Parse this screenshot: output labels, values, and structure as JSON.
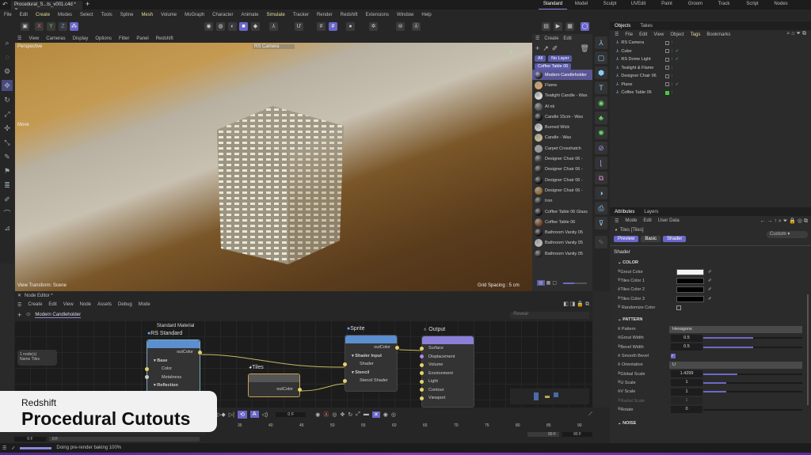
{
  "topbar": {
    "doc_tab": "Procedural_S...ts_v001.c4d *",
    "layouts": [
      "Standard",
      "Model",
      "Sculpt",
      "UVEdit",
      "Paint",
      "Groom",
      "Track",
      "Script",
      "Nodes"
    ]
  },
  "menu": [
    "File",
    "Edit",
    "Create",
    "Modes",
    "Select",
    "Tools",
    "Spline",
    "Mesh",
    "Volume",
    "MoGraph",
    "Character",
    "Animate",
    "Simulate",
    "Tracker",
    "Render",
    "Redshift",
    "Extensions",
    "Window",
    "Help"
  ],
  "toolbar": {
    "x": "X",
    "y": "Y",
    "z": "Z"
  },
  "viewport": {
    "menu": [
      "View",
      "Cameras",
      "Display",
      "Options",
      "Filter",
      "Panel",
      "Redshift"
    ],
    "label": "Perspective",
    "camera": "RS Camera",
    "move": "Move",
    "transform": "View Transform: Scene",
    "grid": "Grid Spacing : 5 cm"
  },
  "materials": {
    "menu": [
      "Create",
      "Edit"
    ],
    "all": "All",
    "nolayer": "No Layer",
    "layer": "Coffee Table 06",
    "items": [
      {
        "n": "Modern Candleholder",
        "c": "#222"
      },
      {
        "n": "Flame",
        "c": "#d8a060"
      },
      {
        "n": "Tealight Candle - Wax",
        "c": "#ddd"
      },
      {
        "n": "Al nk",
        "c": "#555"
      },
      {
        "n": "Candle 15cm - Wax",
        "c": "#111"
      },
      {
        "n": "Burned Wick",
        "c": "#ccc"
      },
      {
        "n": "Candle - Wax",
        "c": "#c8b888"
      },
      {
        "n": "Carpet Crosshatch",
        "c": "#999"
      },
      {
        "n": "Designer Chair 06 -",
        "c": "#333"
      },
      {
        "n": "Designer Chair 06 -",
        "c": "#222"
      },
      {
        "n": "Designer Chair 06 -",
        "c": "#111"
      },
      {
        "n": "Designer Chair 06 -",
        "c": "#9a6a30"
      },
      {
        "n": "Iron",
        "c": "#222"
      },
      {
        "n": "Coffee Table 06 Glass",
        "c": "#111"
      },
      {
        "n": "Coffee Table 06",
        "c": "#7a4420"
      },
      {
        "n": "Bathroom Vanity 05",
        "c": "#111"
      },
      {
        "n": "Bathroom Vanity 05",
        "c": "#bbb"
      },
      {
        "n": "Bathroom Vanity 05",
        "c": "#222"
      }
    ]
  },
  "objects": {
    "tabs": [
      "Objects",
      "Takes"
    ],
    "menu": [
      "File",
      "Edit",
      "View",
      "Object",
      "Tags",
      "Bookmarks"
    ],
    "items": [
      {
        "n": "RS Camera",
        "ok": false
      },
      {
        "n": "Cube",
        "ok": true
      },
      {
        "n": "RS Dome Light",
        "ok": true
      },
      {
        "n": "Tealight & Flame",
        "ok": false
      },
      {
        "n": "Designer Chair 06",
        "ok": false
      },
      {
        "n": "Plane",
        "ok": true
      },
      {
        "n": "Coffee Table 06",
        "ok": false
      }
    ]
  },
  "attributes": {
    "tabs": [
      "Attributes",
      "Layers"
    ],
    "menu": [
      "Mode",
      "Edit",
      "User Data"
    ],
    "object": "Tiles [Tiles]",
    "preset": "Custom",
    "subtabs": [
      "Preview",
      "Basic",
      "Shader"
    ],
    "section": "Shader",
    "color_title": "COLOR",
    "colors": [
      {
        "n": "Grout Color",
        "c": "#f4f4f4"
      },
      {
        "n": "Tiles Color 1",
        "c": "#000000"
      },
      {
        "n": "Tiles Color 2",
        "c": "#000000"
      },
      {
        "n": "Tiles Color 3",
        "c": "#000000"
      }
    ],
    "randomize": "Randomize Color",
    "pattern_title": "PATTERN",
    "pattern_label": "Pattern",
    "pattern": "Hexagons",
    "sliders": [
      {
        "n": "Grout Width",
        "v": "0.5",
        "f": 0.5
      },
      {
        "n": "Bevel Width",
        "v": "0.5",
        "f": 0.5
      }
    ],
    "smooth": "Smooth Bevel",
    "orientation_label": "Orientation",
    "orientation": "U",
    "sliders2": [
      {
        "n": "Global Scale",
        "v": "1.4299",
        "f": 0.34
      },
      {
        "n": "U Scale",
        "v": "1",
        "f": 0.23
      },
      {
        "n": "V Scale",
        "v": "1",
        "f": 0.23
      },
      {
        "n": "Radial Scale",
        "v": "1",
        "f": 0,
        "dim": true
      },
      {
        "n": "Rotate",
        "v": "0",
        "f": 0
      }
    ],
    "noise_title": "NOISE"
  },
  "nodeeditor": {
    "title": "Node Editor *",
    "menu": [
      "Create",
      "Edit",
      "View",
      "Node",
      "Assets",
      "Debug",
      "Mode"
    ],
    "tab": "Modern Candleholder",
    "search_placeholder": "Reveal",
    "info": "1 node(s)",
    "info2": "Name    Tiles",
    "std": {
      "sub": "Standard Material",
      "title": "RS Standard",
      "out": "outColor",
      "base": "Base",
      "color": "Color",
      "metal": "Metalness",
      "refl": "Reflection"
    },
    "tiles": {
      "title": "Tiles",
      "out": "outColor"
    },
    "sprite": {
      "title": "Sprite",
      "out": "outColor",
      "sin": "Shader Input",
      "shader": "Shader",
      "stencil": "Stencil",
      "sshader": "Stencil Shader"
    },
    "output": {
      "title": "Output",
      "ports": [
        "Surface",
        "Displacement",
        "Volume",
        "Environment",
        "Light",
        "Contour",
        "Viewport"
      ]
    }
  },
  "timeline": {
    "frame": "0 F",
    "ticks": [
      "35",
      "40",
      "45",
      "50",
      "55",
      "60",
      "65",
      "70",
      "75",
      "80",
      "85",
      "90"
    ],
    "end1": "90 F",
    "end2": "90 F",
    "start1": "0 F",
    "start2": "0 F"
  },
  "status": {
    "text": "Doing pre-render baking 100%",
    "progress": 1.0
  },
  "titlecard": {
    "sub": "Redshift",
    "title": "Procedural Cutouts"
  }
}
